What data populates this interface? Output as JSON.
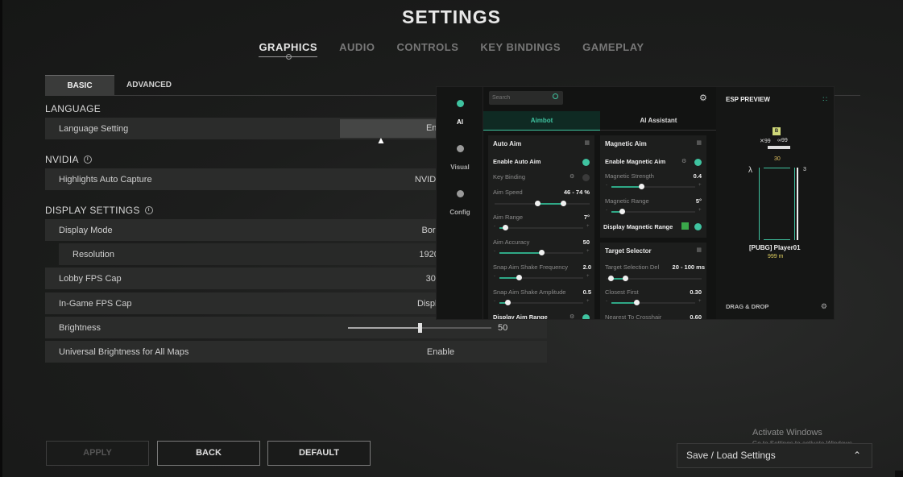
{
  "header": {
    "title": "SETTINGS",
    "tabs": [
      {
        "label": "GRAPHICS",
        "active": true
      },
      {
        "label": "AUDIO",
        "active": false
      },
      {
        "label": "CONTROLS",
        "active": false
      },
      {
        "label": "KEY BINDINGS",
        "active": false
      },
      {
        "label": "GAMEPLAY",
        "active": false
      }
    ]
  },
  "subtabs": [
    {
      "label": "BASIC",
      "active": true
    },
    {
      "label": "ADVANCED",
      "active": false
    }
  ],
  "sections": {
    "language": {
      "title": "LANGUAGE",
      "rows": [
        {
          "label": "Language Setting",
          "value": "English"
        }
      ]
    },
    "nvidia": {
      "title": "NVIDIA",
      "rows": [
        {
          "label": "Highlights Auto Capture",
          "value": "NVIDIA Highl"
        }
      ]
    },
    "display": {
      "title": "DISPLAY SETTINGS",
      "rows": [
        {
          "label": "Display Mode",
          "value": "Borderles"
        },
        {
          "label": "Resolution",
          "value": "1920 * 108"
        },
        {
          "label": "Lobby FPS Cap",
          "value": "30 FPS"
        },
        {
          "label": "In-Game FPS Cap",
          "value": "Display Bas"
        },
        {
          "label": "Brightness",
          "value": "50",
          "level": 0.5
        },
        {
          "label": "Universal Brightness for All Maps",
          "value": "Enable"
        }
      ]
    }
  },
  "buttons": {
    "apply": "APPLY",
    "back": "BACK",
    "default": "DEFAULT"
  },
  "activate": {
    "title": "Activate Windows",
    "sub": "Go to Settings to activate Windows."
  },
  "saveload": {
    "label": "Save / Load Settings"
  },
  "overlay": {
    "accent": "#3fc3a0",
    "side": [
      {
        "label": "AI",
        "icon": "skull-icon",
        "active": true
      },
      {
        "label": "Visual",
        "icon": "eye-icon",
        "active": false
      },
      {
        "label": "Config",
        "icon": "skull-icon",
        "active": false
      }
    ],
    "search_placeholder": "Search",
    "tabs": [
      {
        "label": "Aimbot",
        "active": true
      },
      {
        "label": "AI Assistant",
        "active": false
      }
    ],
    "auto_aim": {
      "title": "Auto Aim",
      "enable": "Enable Auto Aim",
      "key_binding": "Key Binding",
      "aim_speed": {
        "label": "Aim Speed",
        "value": "46 - 74 %"
      },
      "aim_range": {
        "label": "Aim Range",
        "value": "7°"
      },
      "aim_accuracy": {
        "label": "Aim Accuracy",
        "value": "50"
      },
      "snap_freq": {
        "label": "Snap Aim Shake Frequency",
        "value": "2.0"
      },
      "snap_amp": {
        "label": "Snap Aim Shake Amplitude",
        "value": "0.5"
      },
      "display_range": "Display Aim Range"
    },
    "magnetic": {
      "title": "Magnetic Aim",
      "enable": "Enable Magnetic Aim",
      "strength": {
        "label": "Magnetic Strength",
        "value": "0.4"
      },
      "range": {
        "label": "Magnetic Range",
        "value": "5°"
      },
      "display_range": "Display Magnetic Range"
    },
    "target": {
      "title": "Target Selector",
      "delay": {
        "label": "Target Selection Del",
        "value": "20 - 100 ms"
      },
      "closest": {
        "label": "Closest First",
        "value": "0.30"
      },
      "nearest": {
        "label": "Nearest To Crosshair",
        "value": "0.60"
      }
    },
    "esp": {
      "title": "ESP PREVIEW",
      "badge": "B",
      "kills": "99",
      "assists": "99",
      "ammo": "30",
      "side_count": "3",
      "player": "[PUBG] Player01",
      "distance": "999",
      "distance_unit": "m",
      "footer": "DRAG & DROP"
    }
  }
}
